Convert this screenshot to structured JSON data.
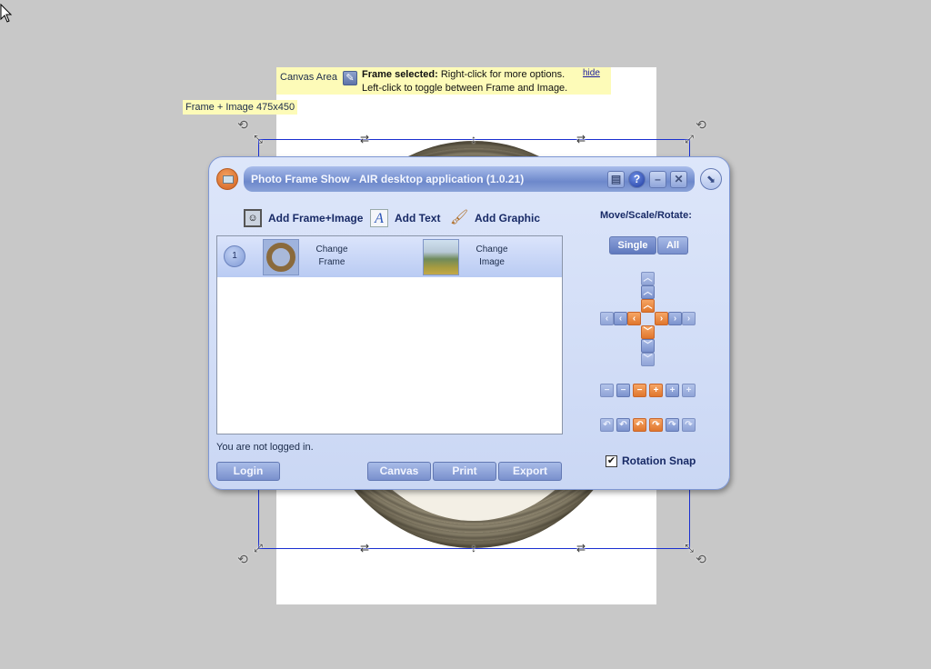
{
  "canvas": {
    "area_label": "Canvas Area",
    "message_title": "Frame selected:",
    "message_line1": "Right-click for more options.",
    "message_line2": "Left-click to toggle between Frame and Image.",
    "hide_link": "hide",
    "frame_size_label": "Frame + Image 475x450"
  },
  "window": {
    "title": "Photo Frame Show - AIR desktop application (1.0.21)",
    "titlebar_buttons": [
      "chat-icon",
      "help-icon",
      "minimize-icon",
      "close-icon"
    ],
    "toolbar": {
      "add_frame_image": "Add Frame+Image",
      "add_text": "Add Text",
      "add_graphic": "Add Graphic"
    },
    "list": {
      "rows": [
        {
          "number": "1",
          "change_frame": "Change\nFrame",
          "change_frame_l1": "Change",
          "change_frame_l2": "Frame",
          "change_image_l1": "Change",
          "change_image_l2": "Image"
        }
      ]
    },
    "status": "You are not logged in.",
    "buttons": {
      "login": "Login",
      "canvas": "Canvas",
      "print": "Print",
      "export": "Export"
    },
    "controls": {
      "title": "Move/Scale/Rotate:",
      "mode_single": "Single",
      "mode_all": "All",
      "active_mode": "Single",
      "rotation_snap_label": "Rotation Snap",
      "rotation_snap_checked": true
    }
  },
  "colors": {
    "accent_orange": "#e57a2f",
    "accent_blue": "#7990cd",
    "selection_line": "#1a2fd0",
    "note_yellow": "#fdfbb8"
  }
}
